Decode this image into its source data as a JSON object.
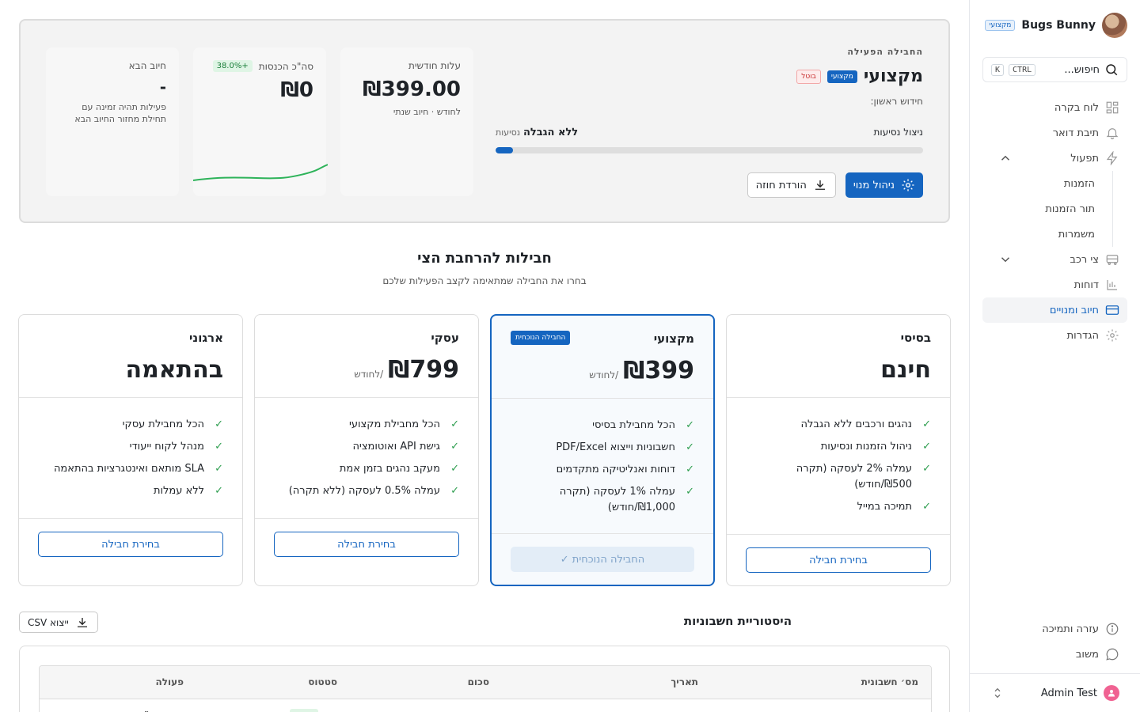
{
  "sidebar": {
    "user_name": "Bugs Bunny",
    "user_badge": "מקצועי",
    "search_placeholder": "חיפוש...",
    "search_kbd_1": "CTRL",
    "search_kbd_2": "K",
    "nav": [
      {
        "label": "לוח בקרה",
        "icon": "dashboard-icon"
      },
      {
        "label": "תיבת דואר",
        "icon": "bell-icon"
      },
      {
        "label": "תפעול",
        "icon": "lightning-icon",
        "expanded": true
      },
      {
        "label": "הזמנות"
      },
      {
        "label": "תור הזמנות"
      },
      {
        "label": "משמרות"
      },
      {
        "label": "צי רכב",
        "icon": "bus-icon",
        "expanded": false
      },
      {
        "label": "דוחות",
        "icon": "chart-icon"
      },
      {
        "label": "חיוב ומנויים",
        "icon": "credit-card-icon",
        "active": true
      },
      {
        "label": "הגדרות",
        "icon": "gear-icon"
      }
    ],
    "help_label": "עזרה ותמיכה",
    "feedback_label": "משוב",
    "footer_user": "Admin Test"
  },
  "active_plan": {
    "section_label": "החבילה הפעילה",
    "plan_name": "מקצועי",
    "plan_badge": "מקצועי",
    "cancel_badge": "בוטל",
    "renewal_label": "חידוש ראשון:",
    "usage_label": "ניצול נסיעות",
    "usage_value": "ללא הגבלה",
    "usage_unit": "נסיעות",
    "usage_fraction": 0.04,
    "manage_button": "ניהול מנוי",
    "download_button": "הורדת חוזה",
    "monthly_cost_label": "עלות חודשית",
    "monthly_cost_value": "₪399.00",
    "monthly_cost_sub": "לחודש · חיוב שנתי",
    "revenue_label": "סה\"כ הכנסות",
    "revenue_change": "+38.0%",
    "revenue_value": "₪0",
    "next_charge_label": "חיוב הבא",
    "next_charge_value": "-",
    "next_charge_sub": "פעילות תהיה זמינה עם תחילת מחזור החיוב הבא"
  },
  "plans_section": {
    "title": "חבילות להרחבת הצי",
    "subtitle": "בחרו את החבילה שמתאימה לקצב הפעילות שלכם"
  },
  "plans": [
    {
      "name": "בסיסי",
      "price": "חינם",
      "per": "",
      "features": [
        "נהגים ורכבים ללא הגבלה",
        "ניהול הזמנות ונסיעות",
        "עמלה 2% לעסקה (תקרה ₪500/חודש)",
        "תמיכה במייל"
      ],
      "button": "בחירת חבילה"
    },
    {
      "name": "מקצועי",
      "price": "₪399",
      "per": "/לחודש",
      "badge": "החבילה הנוכחית",
      "features": [
        "הכל מחבילת בסיסי",
        "חשבוניות וייצוא PDF/Excel",
        "דוחות ואנליטיקה מתקדמים",
        "עמלה 1% לעסקה (תקרה ₪1,000/חודש)"
      ],
      "button": "החבילה הנוכחית ✓"
    },
    {
      "name": "עסקי",
      "price": "₪799",
      "per": "/לחודש",
      "features": [
        "הכל מחבילת מקצועי",
        "גישת API ואוטומציה",
        "מעקב נהגים בזמן אמת",
        "עמלה 0.5% לעסקה (ללא תקרה)"
      ],
      "button": "בחירת חבילה"
    },
    {
      "name": "ארגוני",
      "price": "בהתאמה",
      "per": "",
      "features": [
        "הכל מחבילת עסקי",
        "מנהל לקוח ייעודי",
        "SLA מותאם ואינטגרציות בהתאמה",
        "ללא עמלות"
      ],
      "button": "בחירת חבילה"
    }
  ],
  "history": {
    "title": "היסטוריית חשבוניות",
    "export_button": "ייצוא CSV",
    "columns": [
      "מס׳ חשבונית",
      "תאריך",
      "סכום",
      "סטטוס",
      "פעולה"
    ]
  },
  "colors": {
    "accent": "#1565c0",
    "success": "#2e9e4f",
    "danger": "#c62828"
  }
}
